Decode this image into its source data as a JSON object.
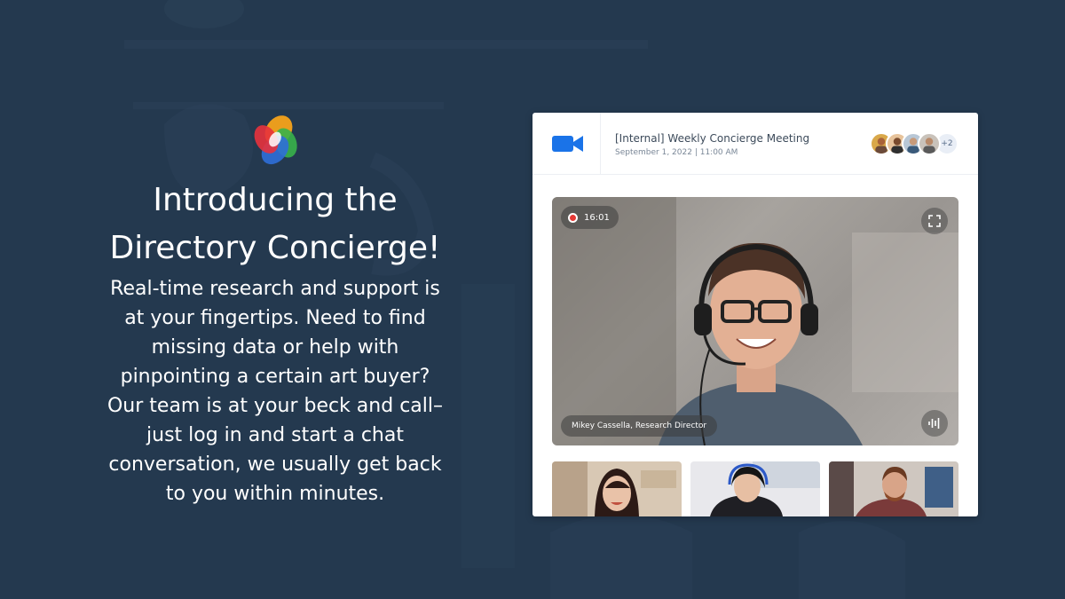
{
  "marketing": {
    "headline_line1": "Introducing the",
    "headline_line2": "Directory Concierge!",
    "body_lines": [
      "Real-time research and support is",
      "at your fingertips. Need to find",
      "missing data or help with",
      "pinpointing a certain art buyer?",
      "Our team is at your beck and call–",
      "just log in and start a chat",
      "conversation, we usually get back",
      "to you within minutes."
    ]
  },
  "meeting": {
    "title": "[Internal] Weekly Concierge Meeting",
    "date": "September 1, 2022 | 11:00 AM",
    "participants_more": "+2",
    "recording_time": "16:01",
    "speaker_label": "Mikey Cassella, Research Director"
  },
  "icons": {
    "logo": "concierge-logo-icon",
    "video": "video-camera-icon",
    "record": "record-icon",
    "fullscreen": "fullscreen-icon",
    "audio": "audio-waveform-icon"
  },
  "colors": {
    "background": "#24394f",
    "brand_blue": "#1a73e8",
    "record_red": "#e53935"
  }
}
